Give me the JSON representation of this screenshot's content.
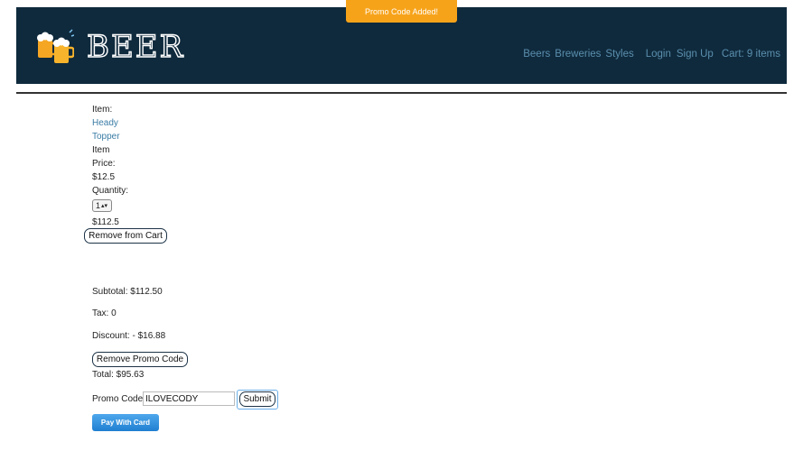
{
  "toast": {
    "text": "Promo Code Added!"
  },
  "header": {
    "brand": "BEER",
    "logo_icon": "beer-mugs-icon",
    "nav": {
      "beers": "Beers",
      "breweries": "Breweries",
      "styles": "Styles",
      "login": "Login",
      "signup": "Sign Up",
      "cart": "Cart: 9 items"
    }
  },
  "cart_item": {
    "item_label": "Item:",
    "name_line1": "Heady",
    "name_line2": "Topper",
    "item_word": "Item",
    "price_label": "Price:",
    "price": "$12.5",
    "quantity_label": "Quantity:",
    "quantity": "1",
    "line_total": "$112.5",
    "remove_label": "Remove from Cart"
  },
  "summary": {
    "subtotal": "Subtotal: $112.50",
    "tax": "Tax: 0",
    "discount": "Discount: - $16.88",
    "remove_promo_label": "Remove Promo Code",
    "total": "Total: $95.63"
  },
  "promo": {
    "label": "Promo Code:",
    "value": "ILOVECODY",
    "submit_label": "Submit"
  },
  "pay": {
    "label": "Pay With Card"
  },
  "colors": {
    "header_bg": "#0f2a3d",
    "toast_bg": "#f7a31a",
    "link": "#3a7ca5",
    "nav_link": "#5b8fae",
    "pay_btn": "#2a8ee0"
  }
}
